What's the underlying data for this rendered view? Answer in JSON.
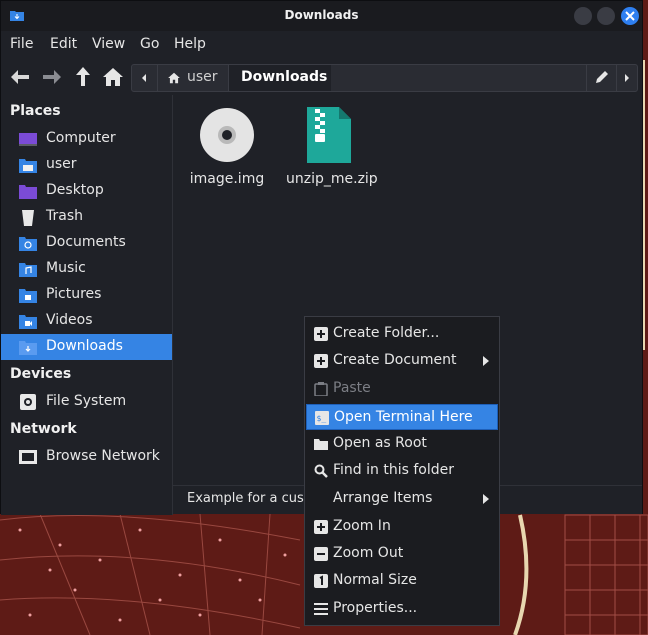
{
  "window": {
    "title": "Downloads"
  },
  "menubar": [
    "File",
    "Edit",
    "View",
    "Go",
    "Help"
  ],
  "pathbar": {
    "segments": [
      "user",
      "Downloads"
    ]
  },
  "sidebar": {
    "places_heading": "Places",
    "places": [
      "Computer",
      "user",
      "Desktop",
      "Trash",
      "Documents",
      "Music",
      "Pictures",
      "Videos",
      "Downloads"
    ],
    "devices_heading": "Devices",
    "devices": [
      "File System"
    ],
    "network_heading": "Network",
    "network": [
      "Browse Network"
    ]
  },
  "files": [
    {
      "name": "image.img",
      "icon": "disc-image-icon"
    },
    {
      "name": "unzip_me.zip",
      "icon": "zip-archive-icon"
    }
  ],
  "status": {
    "text": "Example for a cust"
  },
  "context_menu": {
    "items": [
      {
        "label": "Create Folder...",
        "icon": "plus-icon"
      },
      {
        "label": "Create Document",
        "icon": "plus-icon",
        "submenu": true
      },
      {
        "label": "Paste",
        "icon": "clipboard-icon",
        "disabled": true
      },
      {
        "label": "Open Terminal Here",
        "icon": "terminal-icon",
        "highlighted": true
      },
      {
        "label": "Open as Root",
        "icon": "folder-icon"
      },
      {
        "label": "Find in this folder",
        "icon": "search-icon"
      },
      {
        "label": "Arrange Items",
        "icon": "",
        "submenu": true
      },
      {
        "label": "Zoom In",
        "icon": "plus-icon"
      },
      {
        "label": "Zoom Out",
        "icon": "minus-icon"
      },
      {
        "label": "Normal Size",
        "icon": "one-icon"
      },
      {
        "label": "Properties...",
        "icon": "properties-icon"
      }
    ]
  },
  "colors": {
    "accent": "#3584e4",
    "window_bg": "#1f2127",
    "wallpaper": "#5a1a14"
  }
}
